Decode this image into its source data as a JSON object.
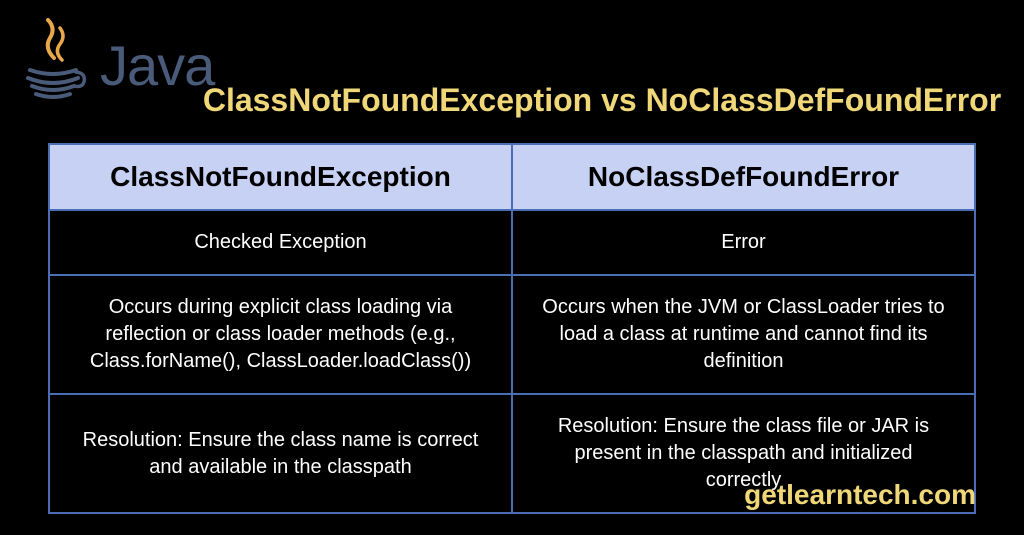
{
  "header": {
    "logo_text": "Java",
    "title": "ClassNotFoundException vs NoClassDefFoundError"
  },
  "table": {
    "headers": [
      "ClassNotFoundException",
      "NoClassDefFoundError"
    ],
    "rows": [
      {
        "left": "Checked Exception",
        "right": "Error"
      },
      {
        "left": "Occurs during explicit class loading via reflection or class loader methods (e.g., Class.forName(), ClassLoader.loadClass())",
        "right": "Occurs when the JVM or ClassLoader tries to load a class at runtime and cannot find its definition"
      },
      {
        "left": "Resolution: Ensure the class name is correct and available in the classpath",
        "right": "Resolution: Ensure the class file or JAR is present in the classpath and initialized correctly"
      }
    ]
  },
  "footer": {
    "site": "getlearntech.com"
  }
}
